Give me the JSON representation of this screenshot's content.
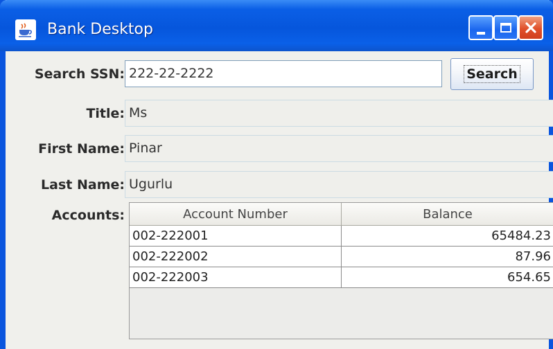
{
  "window": {
    "title": "Bank Desktop"
  },
  "form": {
    "search": {
      "label": "Search SSN:",
      "value": "222-22-2222",
      "button_label": "Search"
    },
    "title": {
      "label": "Title:",
      "value": "Ms"
    },
    "first_name": {
      "label": "First Name:",
      "value": "Pinar"
    },
    "last_name": {
      "label": "Last Name:",
      "value": "Ugurlu"
    },
    "accounts": {
      "label": "Accounts:",
      "columns": [
        "Account Number",
        "Balance"
      ],
      "rows": [
        {
          "account_number": "002-222001",
          "balance": "65484.23"
        },
        {
          "account_number": "002-222002",
          "balance": "87.96"
        },
        {
          "account_number": "002-222003",
          "balance": "654.65"
        }
      ]
    }
  },
  "icons": {
    "app": "java-coffee-cup-icon",
    "minimize": "minimize-icon",
    "maximize": "maximize-icon",
    "close": "close-icon"
  },
  "colors": {
    "titlebar": "#0656dc",
    "window_bg": "#f0f0ec",
    "close_button": "#e0502a"
  }
}
